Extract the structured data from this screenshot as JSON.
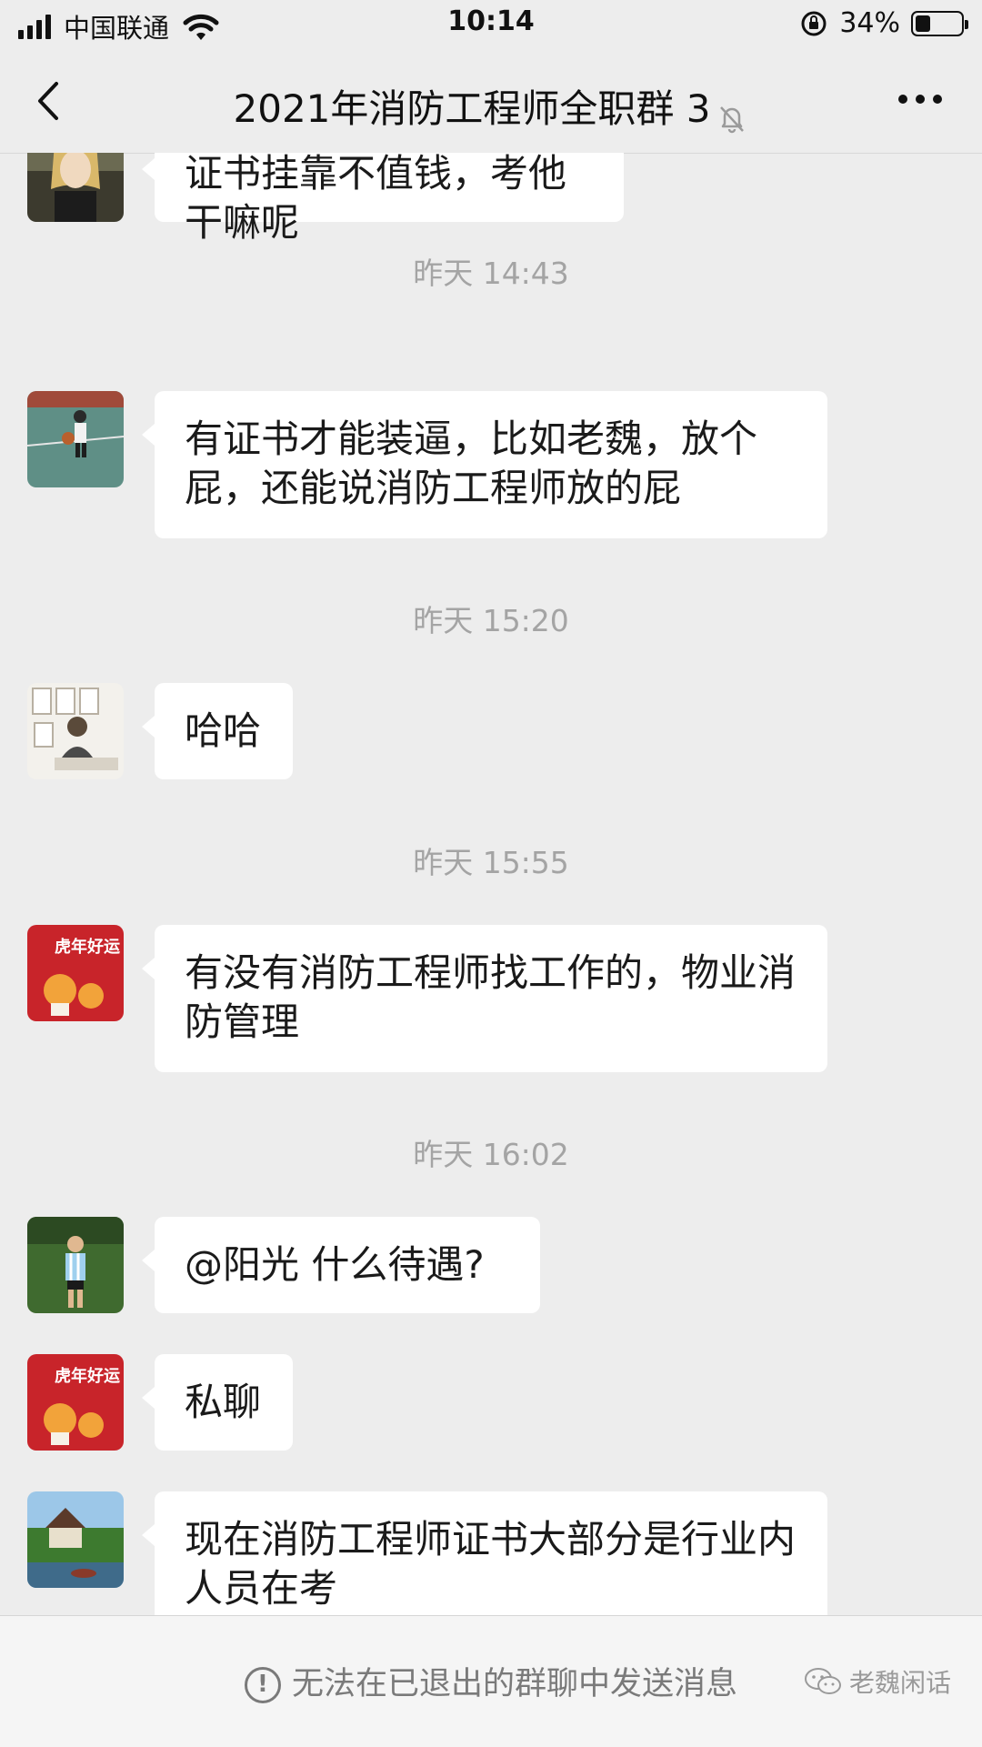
{
  "status_bar": {
    "carrier": "中国联通",
    "time": "10:14",
    "battery_percent": "34%",
    "battery_level": 0.34
  },
  "nav": {
    "title": "2021年消防工程师全职群 3",
    "muted": true
  },
  "messages": [
    {
      "type": "bubble",
      "avatar": "avatar-anime",
      "text": "证书挂靠不值钱，考他干嘛呢"
    },
    {
      "type": "time",
      "text": "昨天 14:43"
    },
    {
      "type": "bubble",
      "avatar": "avatar-child-basketball",
      "text": "有证书才能装逼，比如老魏，放个屁，还能说消防工程师放的屁"
    },
    {
      "type": "time",
      "text": "昨天 15:20"
    },
    {
      "type": "bubble",
      "avatar": "avatar-cartoon-room",
      "text": "哈哈"
    },
    {
      "type": "time",
      "text": "昨天 15:55"
    },
    {
      "type": "bubble",
      "avatar": "avatar-tiger",
      "avatar_text": "虎年好运",
      "text": "有没有消防工程师找工作的，物业消防管理"
    },
    {
      "type": "time",
      "text": "昨天 16:02"
    },
    {
      "type": "bubble",
      "avatar": "avatar-football",
      "text": "@阳光 什么待遇?"
    },
    {
      "type": "bubble",
      "avatar": "avatar-tiger",
      "avatar_text": "虎年好运",
      "text": "私聊"
    },
    {
      "type": "bubble",
      "avatar": "avatar-garden",
      "text": "现在消防工程师证书大部分是行业内人员在考"
    }
  ],
  "bottom_bar": {
    "notice": "无法在已退出的群聊中发送消息",
    "watermark": "老魏闲话"
  },
  "colors": {
    "background": "#ededed",
    "bubble": "#ffffff",
    "timestamp": "#a4a4a4"
  }
}
